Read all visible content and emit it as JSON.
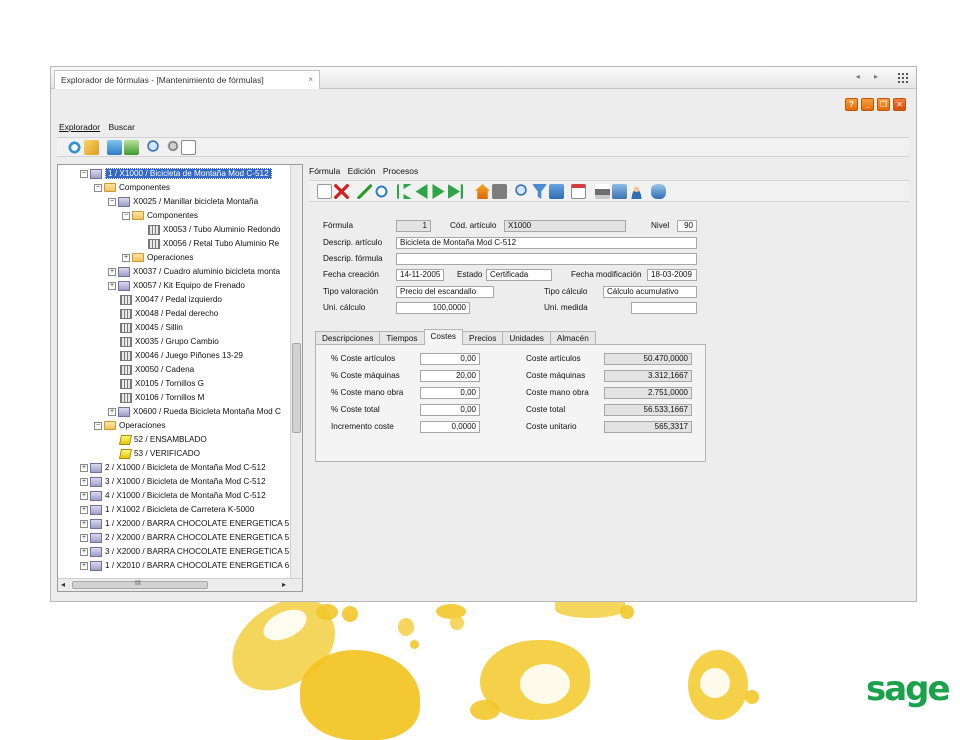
{
  "window": {
    "tab_title": "Explorador de fórmulas - [Mantenimiento de fórmulas]",
    "tab_close": "×",
    "nav_arrows": "◂ ▸",
    "buttons": [
      "?",
      "_",
      "❐",
      "✕"
    ]
  },
  "menu1": {
    "items": [
      "Explorador",
      "Buscar"
    ]
  },
  "tree": {
    "rows": [
      {
        "level": 0,
        "exp": "−",
        "icon": "assy",
        "label": "1 / X1000 / Bicicleta de Montaña Mod C-512",
        "selected": true
      },
      {
        "level": 1,
        "exp": "−",
        "icon": "folder",
        "label": "Componentes"
      },
      {
        "level": 2,
        "exp": "−",
        "icon": "assy",
        "label": "X0025 / Manillar bicicleta  Montaña"
      },
      {
        "level": 3,
        "exp": "−",
        "icon": "folder",
        "label": "Componentes"
      },
      {
        "level": 4,
        "exp": "",
        "icon": "part",
        "label": "X0053 / Tubo Aluminio Redondo"
      },
      {
        "level": 4,
        "exp": "",
        "icon": "part",
        "label": "X0056 / Retal  Tubo Aluminio Re"
      },
      {
        "level": 3,
        "exp": "+",
        "icon": "folder",
        "label": "Operaciones"
      },
      {
        "level": 2,
        "exp": "+",
        "icon": "assy",
        "label": "X0037 / Cuadro aluminio bicicleta  monta"
      },
      {
        "level": 2,
        "exp": "+",
        "icon": "assy",
        "label": "X0057 / Kit Equipo de Frenado"
      },
      {
        "level": 2,
        "exp": "",
        "icon": "part",
        "label": "X0047 / Pedal izquierdo"
      },
      {
        "level": 2,
        "exp": "",
        "icon": "part",
        "label": "X0048 / Pedal derecho"
      },
      {
        "level": 2,
        "exp": "",
        "icon": "part",
        "label": "X0045 / Sillin"
      },
      {
        "level": 2,
        "exp": "",
        "icon": "part",
        "label": "X0035 / Grupo Cambio"
      },
      {
        "level": 2,
        "exp": "",
        "icon": "part",
        "label": "X0046 / Juego Piñones 13-29"
      },
      {
        "level": 2,
        "exp": "",
        "icon": "part",
        "label": "X0050 / Cadena"
      },
      {
        "level": 2,
        "exp": "",
        "icon": "part",
        "label": "X0105 / Tornillos G"
      },
      {
        "level": 2,
        "exp": "",
        "icon": "part",
        "label": "X0106 / Tornillos M"
      },
      {
        "level": 2,
        "exp": "+",
        "icon": "assy",
        "label": "X0600 / Rueda Bicicleta Montaña Mod C"
      },
      {
        "level": 1,
        "exp": "−",
        "icon": "folder",
        "label": "Operaciones"
      },
      {
        "level": 2,
        "exp": "",
        "icon": "oper",
        "label": "52 / ENSAMBLADO"
      },
      {
        "level": 2,
        "exp": "",
        "icon": "oper",
        "label": "53 / VERIFICADO"
      },
      {
        "level": 0,
        "exp": "+",
        "icon": "assy",
        "label": "2 / X1000 / Bicicleta de Montaña Mod C-512"
      },
      {
        "level": 0,
        "exp": "+",
        "icon": "assy",
        "label": "3 / X1000 / Bicicleta de Montaña Mod C-512"
      },
      {
        "level": 0,
        "exp": "+",
        "icon": "assy",
        "label": "4 / X1000 / Bicicleta de Montaña Mod C-512"
      },
      {
        "level": 0,
        "exp": "+",
        "icon": "assy",
        "label": "1 / X1002 / Bicicleta de Carretera K-5000"
      },
      {
        "level": 0,
        "exp": "+",
        "icon": "assy",
        "label": "1 / X2000 / BARRA CHOCOLATE ENERGETICA 5"
      },
      {
        "level": 0,
        "exp": "+",
        "icon": "assy",
        "label": "2 / X2000 / BARRA CHOCOLATE ENERGETICA 5"
      },
      {
        "level": 0,
        "exp": "+",
        "icon": "assy",
        "label": "3 / X2000 / BARRA CHOCOLATE ENERGETICA 5"
      },
      {
        "level": 0,
        "exp": "+",
        "icon": "assy",
        "label": "1 / X2010 / BARRA CHOCOLATE ENERGETICA 6"
      }
    ],
    "hscroll_grip": "III"
  },
  "menu2": {
    "items": [
      "Fórmula",
      "Edición",
      "Procesos"
    ]
  },
  "form": {
    "formula_label": "Fórmula",
    "formula_value": "1",
    "cod_label": "Cód. artículo",
    "cod_value": "X1000",
    "nivel_label": "Nivel",
    "nivel_value": "90",
    "descrip_art_label": "Descrip. artículo",
    "descrip_art_value": "Bicicleta de Montaña Mod C-512",
    "descrip_form_label": "Descrip. fórmula",
    "descrip_form_value": "",
    "fecha_creacion_label": "Fecha creación",
    "fecha_creacion_value": "14-11-2005",
    "estado_label": "Estado",
    "estado_value": "Certificada",
    "fecha_mod_label": "Fecha modificación",
    "fecha_mod_value": "18-03-2009",
    "tipo_val_label": "Tipo valoración",
    "tipo_val_value": "Precio del escandallo",
    "tipo_calc_label": "Tipo cálculo",
    "tipo_calc_value": "Cálculo acumulativo",
    "uni_calc_label": "Uni. cálculo",
    "uni_calc_value": "100,0000",
    "uni_medida_label": "Uni. medida",
    "uni_medida_value": ""
  },
  "tabs": [
    "Descripciones",
    "Tiempos",
    "Costes",
    "Precios",
    "Unidades",
    "Almacén"
  ],
  "active_tab": "Costes",
  "costes": {
    "left": [
      {
        "label": "% Coste artículos",
        "value": "0,00"
      },
      {
        "label": "% Coste máquinas",
        "value": "20,00"
      },
      {
        "label": "% Coste mano obra",
        "value": "0,00"
      },
      {
        "label": "% Coste total",
        "value": "0,00"
      },
      {
        "label": "Incremento coste",
        "value": "0,0000"
      }
    ],
    "right": [
      {
        "label": "Coste artículos",
        "value": "50.470,0000"
      },
      {
        "label": "Coste máquinas",
        "value": "3.312,1667"
      },
      {
        "label": "Coste mano obra",
        "value": "2.751,0000"
      },
      {
        "label": "Coste total",
        "value": "56.533,1667"
      },
      {
        "label": "Coste unitario",
        "value": "565,3317"
      }
    ]
  },
  "logo": "sage",
  "colors": {
    "brand_green": "#1aa14a",
    "blob_yellow": "#f5c518",
    "selection": "#3468c6"
  }
}
